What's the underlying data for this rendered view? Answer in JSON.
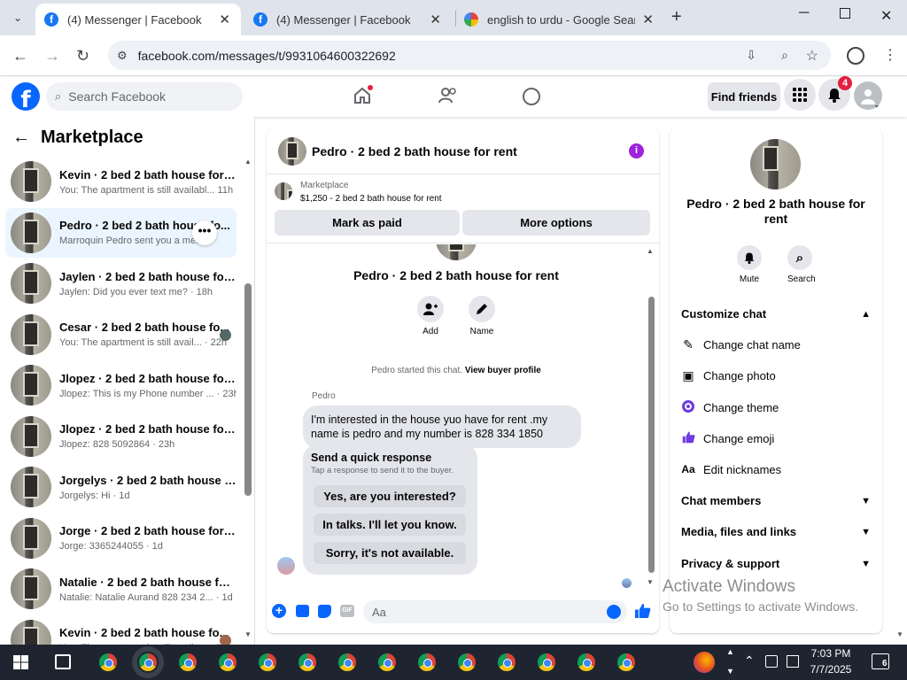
{
  "browser": {
    "tabs": [
      {
        "title": "(4) Messenger | Facebook",
        "favicon": "facebook-icon"
      },
      {
        "title": "(4) Messenger | Facebook",
        "favicon": "facebook-icon"
      },
      {
        "title": "english to urdu - Google Search",
        "favicon": "google-icon"
      }
    ],
    "new_tab": "+",
    "url": "facebook.com/messages/t/9931064600322692"
  },
  "fb": {
    "logo": "f",
    "search_placeholder": "Search Facebook",
    "find_friends": "Find friends",
    "notif_count": "4"
  },
  "left": {
    "title": "Marketplace",
    "conversations": [
      {
        "name": "Kevin · 2 bed 2 bath house for r...",
        "preview": "You: The apartment is still availabl... 11h"
      },
      {
        "name": "Pedro · 2 bed 2 bath house fo...",
        "preview": "Marroquin Pedro sent you a mes..."
      },
      {
        "name": "Jaylen · 2 bed 2 bath house for ...",
        "preview": "Jaylen: Did you ever text me? · 18h"
      },
      {
        "name": "Cesar · 2 bed 2 bath house fo...",
        "preview": "You: The apartment is still avail... · 22h"
      },
      {
        "name": "Jlopez · 2 bed 2 bath house for ...",
        "preview": "Jlopez: This is my Phone number ... · 23h"
      },
      {
        "name": "Jlopez · 2 bed 2 bath house for ...",
        "preview": "Jlopez: 828 5092864 · 23h"
      },
      {
        "name": "Jorgelys · 2 bed 2 bath house fo...",
        "preview": "Jorgelys: Hi · 1d"
      },
      {
        "name": "Jorge · 2 bed 2 bath house for r...",
        "preview": "Jorge: 3365244055 · 1d"
      },
      {
        "name": "Natalie · 2 bed 2 bath house for...",
        "preview": "Natalie: Natalie Aurand 828 234 2... · 1d"
      },
      {
        "name": "Kevin · 2 bed 2 bath house fo...",
        "preview": "You: The apartment is still availa... · 2d"
      }
    ]
  },
  "chat": {
    "title": "Pedro · 2 bed 2 bath house for rent",
    "listing_label": "Marketplace",
    "listing_price": "$1,250 - 2 bed 2 bath house for rent",
    "mark_paid": "Mark as paid",
    "more_options": "More options",
    "header_name": "Pedro · 2 bed 2 bath house for rent",
    "add_label": "Add",
    "name_label": "Name",
    "started": "Pedro started this chat.",
    "view_buyer": "View buyer profile",
    "sender": "Pedro",
    "message": "I'm interested  in the house yuo have for rent .my name is pedro and my number is 828 334 1850",
    "quick_title": "Send a quick response",
    "quick_sub": "Tap a response to send it to the buyer.",
    "quick_replies": [
      "Yes, are you interested?",
      "In talks. I'll let you know.",
      "Sorry, it's not available."
    ],
    "composer_placeholder": "Aa"
  },
  "right": {
    "name": "Pedro · 2 bed 2 bath house for rent",
    "mute": "Mute",
    "search": "Search",
    "customize": "Customize chat",
    "items": [
      {
        "label": "Change chat name",
        "icon": "pencil-icon"
      },
      {
        "label": "Change photo",
        "icon": "photo-icon"
      },
      {
        "label": "Change theme",
        "icon": "theme-icon"
      },
      {
        "label": "Change emoji",
        "icon": "thumbs-up-icon"
      },
      {
        "label": "Edit nicknames",
        "icon": "text-icon"
      }
    ],
    "members": "Chat members",
    "media": "Media, files and links",
    "privacy": "Privacy & support"
  },
  "watermark": {
    "line1": "Activate Windows",
    "line2": "Go to Settings to activate Windows."
  },
  "taskbar": {
    "time": "7:03 PM",
    "date": "7/7/2025",
    "notif": "6"
  },
  "colors": {
    "fb_blue": "#0866ff",
    "selected_bg": "#ebf5ff",
    "info_purple": "#9d24dc",
    "badge_red": "#e41e3f"
  }
}
